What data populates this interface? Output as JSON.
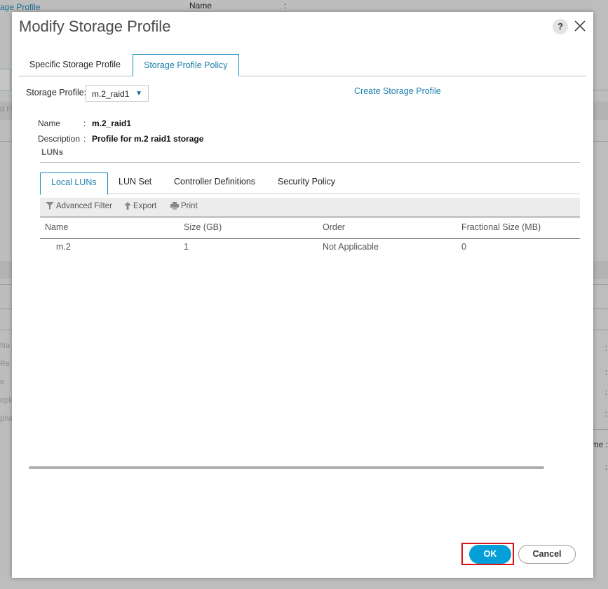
{
  "background": {
    "link_fragment": "age Profile",
    "name_label": "Name",
    "name_colon": ":",
    "filter_fragment": "d Fi",
    "frag_1": "Na",
    "frag_2": "Re",
    "frag_3": "e",
    "frag_4": "eplo",
    "frag_5": "pha",
    "right_colon": ":",
    "right_me": "me :"
  },
  "dialog": {
    "title": "Modify Storage Profile",
    "help_label": "?",
    "outer_tabs": [
      {
        "label": "Specific Storage Profile",
        "active": false
      },
      {
        "label": "Storage Profile Policy",
        "active": true
      }
    ],
    "storage_profile": {
      "label": "Storage Profile:",
      "selected": "m.2_raid1",
      "create_link": "Create Storage Profile"
    },
    "details": {
      "name_key": "Name",
      "name_colon": ":",
      "name_value": "m.2_raid1",
      "desc_key": "Description",
      "desc_colon": ":",
      "desc_value": "Profile for m.2 raid1 storage"
    },
    "luns_section_label": "LUNs",
    "inner_tabs": [
      {
        "label": "Local LUNs",
        "active": true
      },
      {
        "label": "LUN Set",
        "active": false
      },
      {
        "label": "Controller Definitions",
        "active": false
      },
      {
        "label": "Security Policy",
        "active": false
      }
    ],
    "toolbar": {
      "filter": "Advanced Filter",
      "export": "Export",
      "print": "Print"
    },
    "table": {
      "columns": [
        "Name",
        "Size (GB)",
        "Order",
        "Fractional Size (MB)"
      ],
      "rows": [
        [
          "m.2",
          "1",
          "Not Applicable",
          "0"
        ]
      ]
    },
    "buttons": {
      "ok": "OK",
      "cancel": "Cancel"
    },
    "colors": {
      "accent": "#049fd9",
      "link": "#1b7fae",
      "highlight": "#d9141b"
    },
    "icons": [
      "help-icon",
      "close-icon",
      "dropdown-caret-icon",
      "filter-icon",
      "export-icon",
      "print-icon"
    ]
  }
}
